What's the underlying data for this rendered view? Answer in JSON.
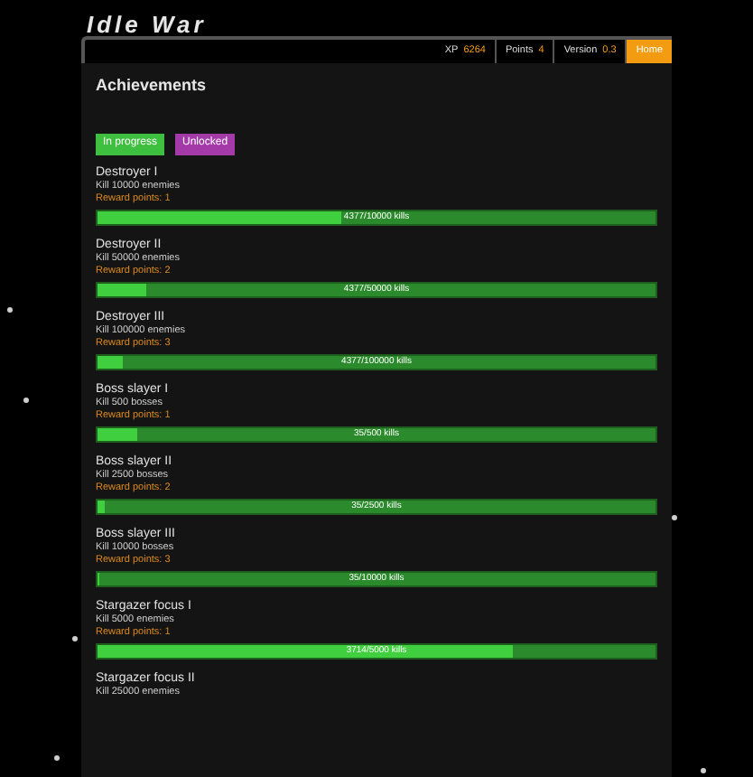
{
  "app_title": "Idle War",
  "header_tabs": [
    {
      "label": "XP",
      "value": "6264",
      "selected": false
    },
    {
      "label": "Points",
      "value": "4",
      "selected": false
    },
    {
      "label": "Version",
      "value": "0.3",
      "selected": false
    },
    {
      "label": "Home",
      "selected": true
    }
  ],
  "page_title": "Achievements",
  "filters": [
    {
      "label": "In progress",
      "color": "#3fbf3f"
    },
    {
      "label": "Unlocked",
      "color": "#a43aa8"
    }
  ],
  "achievements": [
    {
      "name": "Destroyer I",
      "description": "Kill 10000 enemies",
      "reward": "Reward points: 1",
      "progress": "4377/10000 kills",
      "level": 0.4377
    },
    {
      "name": "Destroyer II",
      "description": "Kill 50000 enemies",
      "reward": "Reward points: 2",
      "progress": "4377/50000 kills",
      "level": 0.0875
    },
    {
      "name": "Destroyer III",
      "description": "Kill 100000 enemies",
      "reward": "Reward points: 3",
      "progress": "4377/100000 kills",
      "level": 0.044
    },
    {
      "name": "Boss slayer I",
      "description": "Kill 500 bosses",
      "reward": "Reward points: 1",
      "progress": "35/500 kills",
      "level": 0.07
    },
    {
      "name": "Boss slayer II",
      "description": "Kill 2500 bosses",
      "reward": "Reward points: 2",
      "progress": "35/2500 kills",
      "level": 0.014
    },
    {
      "name": "Boss slayer III",
      "description": "Kill 10000 bosses",
      "reward": "Reward points: 3",
      "progress": "35/10000 kills",
      "level": 0.0035
    },
    {
      "name": "Stargazer focus I",
      "description": "Kill 5000 enemies",
      "reward": "Reward points: 1",
      "progress": "3714/5000 kills",
      "level": 0.7428
    },
    {
      "name": "Stargazer focus II",
      "description": "Kill 25000 enemies"
    }
  ]
}
